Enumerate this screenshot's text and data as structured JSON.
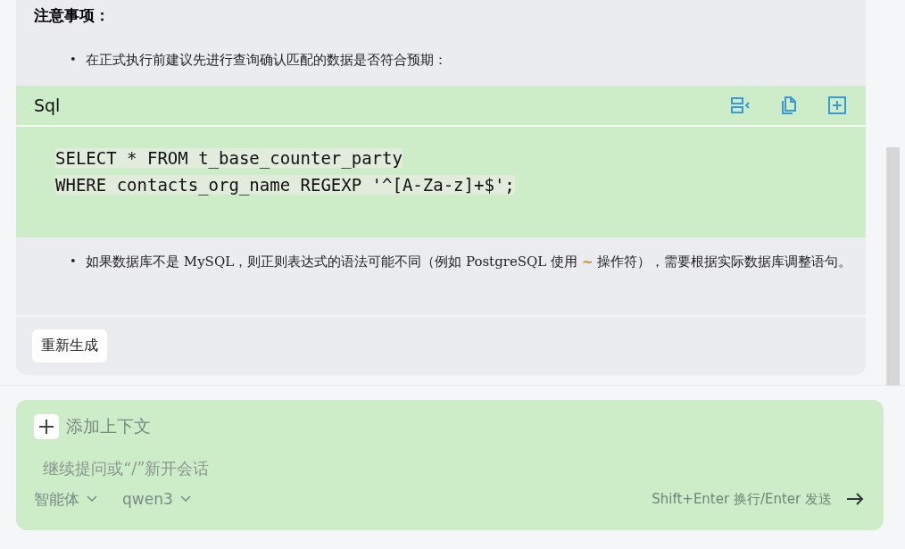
{
  "message": {
    "heading": "注意事项：",
    "bullets_before": [
      {
        "marker": "•",
        "parts": [
          {
            "kind": "plain",
            "text": "在正式执行前建议先进行查询确认匹配的数据是否符合预期："
          }
        ]
      }
    ],
    "code_block": {
      "language": "Sql",
      "lines": [
        "SELECT * FROM t_base_counter_party",
        "WHERE contacts_org_name REGEXP '^[A-Za-z]+$';"
      ]
    },
    "bullets_after": [
      {
        "marker": "•",
        "parts": [
          {
            "kind": "plain",
            "text": "如果数据库不是 MySQL，则正则表达式的语法可能不同（例如 PostgreSQL 使用 "
          },
          {
            "kind": "code",
            "text": "~"
          },
          {
            "kind": "plain",
            "text": " 操作符），需要根据实际数据库调整语句。"
          }
        ]
      }
    ],
    "regenerate_button": "重新生成"
  },
  "composer": {
    "add_context": "添加上下文",
    "placeholder": "继续提问或“/”新开会话",
    "agent": "智能体",
    "model": "qwen3",
    "hint": "Shift+Enter 换行/Enter 发送"
  }
}
